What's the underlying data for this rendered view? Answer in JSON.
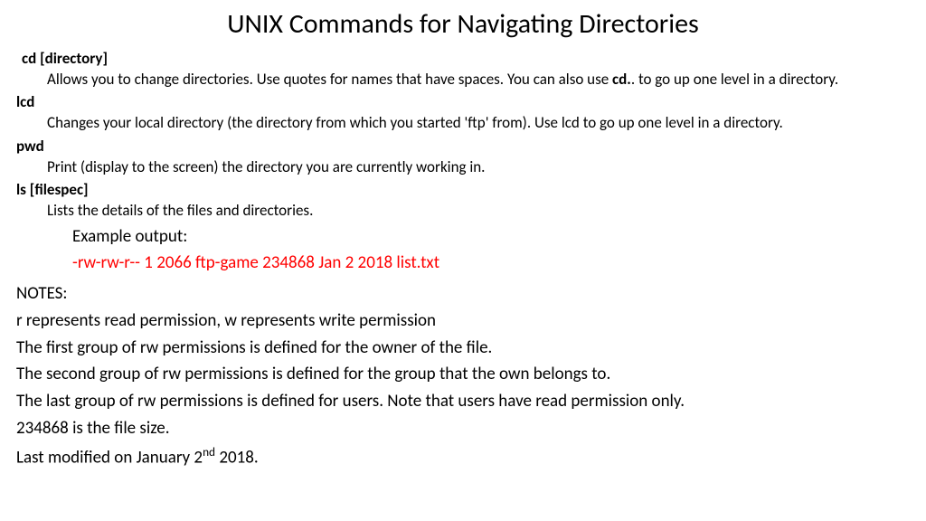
{
  "title": "UNIX Commands for Navigating Directories",
  "commands": {
    "cd": {
      "name": "cd [directory]",
      "desc_before": "Allows you to change directories. Use quotes for names that have spaces. You can also use ",
      "desc_bold": "cd.",
      "desc_after": ". to go up one level in a directory."
    },
    "lcd": {
      "name": "lcd",
      "desc": "Changes your local directory (the directory from which you started 'ftp' from).  Use lcd to go up one level in a directory."
    },
    "pwd": {
      "name": "pwd",
      "desc": "Print (display to the screen) the directory you are currently working in."
    },
    "ls": {
      "name": "ls [filespec]",
      "desc": "Lists the details of the files and directories.",
      "example_label": "Example output:",
      "example_output": "-rw-rw-r--  1 2066  ftp-game  234868 Jan 2  2018 list.txt"
    }
  },
  "notes": {
    "header": "NOTES:",
    "line1": "r represents read permission, w represents write permission",
    "line2": "The first group of rw permissions is defined for the owner of the file.",
    "line3": "The second group of rw permissions is defined for the group that the own belongs to.",
    "line4": "The last group of rw permissions is defined for users.  Note that users have read permission only.",
    "line5": "234868 is the file size.",
    "line6_before": "Last modified on January 2",
    "line6_sup": "nd",
    "line6_after": " 2018."
  }
}
